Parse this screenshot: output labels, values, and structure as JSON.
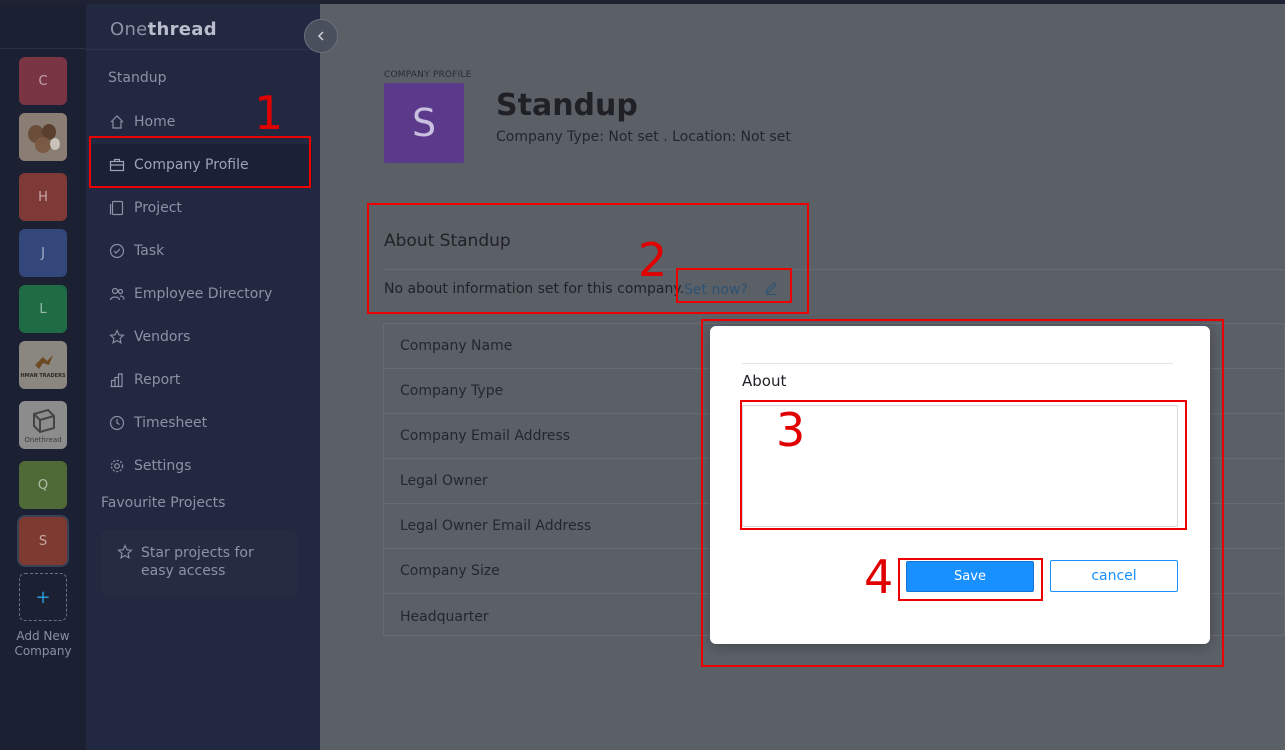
{
  "app": {
    "brand_light": "One",
    "brand_bold": "thread"
  },
  "rail": {
    "companies": [
      {
        "initial": "C",
        "color": "#7a3544"
      },
      {
        "initial": "",
        "color": "#7c7068",
        "kind": "image"
      },
      {
        "initial": "H",
        "color": "#7e3a36"
      },
      {
        "initial": "J",
        "color": "#33477a"
      },
      {
        "initial": "L",
        "color": "#1f6b44"
      },
      {
        "initial": "",
        "color": "#8a8680",
        "kind": "image"
      },
      {
        "initial": "",
        "color": "#8c8c8c",
        "kind": "image"
      },
      {
        "initial": "Q",
        "color": "#4f6a36"
      },
      {
        "initial": "S",
        "color": "#7d3a30",
        "selected": true
      }
    ],
    "logo_tile_text": "HMAN TRADERS",
    "onethread_tile_text": "Onethread",
    "add_icon": "+",
    "add_label": "Add New Company"
  },
  "nav": {
    "company_name": "Standup",
    "collapse_icon": "chevron-left",
    "items": [
      {
        "label": "Home",
        "icon": "home-icon"
      },
      {
        "label": "Company Profile",
        "icon": "briefcase-icon",
        "active": true
      },
      {
        "label": "Project",
        "icon": "project-icon"
      },
      {
        "label": "Task",
        "icon": "check-circle-icon"
      },
      {
        "label": "Employee Directory",
        "icon": "users-icon"
      },
      {
        "label": "Vendors",
        "icon": "star-icon"
      },
      {
        "label": "Report",
        "icon": "report-icon"
      },
      {
        "label": "Timesheet",
        "icon": "clock-icon"
      },
      {
        "label": "Settings",
        "icon": "gear-icon"
      }
    ],
    "favourites_title": "Favourite Projects",
    "favourites_empty": "Star projects for easy access"
  },
  "main": {
    "section_label": "COMPANY PROFILE",
    "avatar_initial": "S",
    "avatar_color": "#5b3a8c",
    "company_title": "Standup",
    "company_meta": "Company Type: Not set . Location: Not set",
    "about_title": "About Standup",
    "about_empty": "No about information set for this company.",
    "set_now": "Set now?",
    "fields": [
      "Company Name",
      "Company Type",
      "Company Email Address",
      "Legal Owner",
      "Legal Owner Email Address",
      "Company Size",
      "Headquarter"
    ]
  },
  "modal": {
    "label": "About",
    "textarea_value": "",
    "save_label": "Save",
    "cancel_label": "cancel",
    "accent": "#1890ff"
  },
  "annotations": [
    "1",
    "2",
    "3",
    "4"
  ]
}
